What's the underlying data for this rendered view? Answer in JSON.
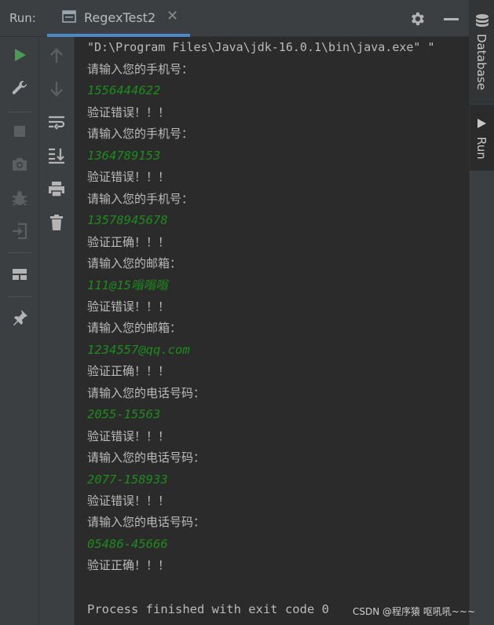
{
  "header": {
    "run_label": "Run:",
    "tab_title": "RegexTest2",
    "tab_close": "✕"
  },
  "console": {
    "command": "\"D:\\Program Files\\Java\\jdk-16.0.1\\bin\\java.exe\" \"",
    "lines": [
      {
        "type": "prompt",
        "text": "请输入您的手机号："
      },
      {
        "type": "input",
        "text": "1556444622"
      },
      {
        "type": "result",
        "text": "验证错误！！！"
      },
      {
        "type": "prompt",
        "text": "请输入您的手机号："
      },
      {
        "type": "input",
        "text": "1364789153"
      },
      {
        "type": "result",
        "text": "验证错误！！！"
      },
      {
        "type": "prompt",
        "text": "请输入您的手机号："
      },
      {
        "type": "input",
        "text": "13578945678"
      },
      {
        "type": "result",
        "text": "验证正确！！！"
      },
      {
        "type": "prompt",
        "text": "请输入您的邮箱："
      },
      {
        "type": "input",
        "text": "111@15嗡嗡嗡"
      },
      {
        "type": "result",
        "text": "验证错误！！！"
      },
      {
        "type": "prompt",
        "text": "请输入您的邮箱："
      },
      {
        "type": "input",
        "text": "1234557@qq.com"
      },
      {
        "type": "result",
        "text": "验证正确！！！"
      },
      {
        "type": "prompt",
        "text": "请输入您的电话号码："
      },
      {
        "type": "input",
        "text": "2055-15563"
      },
      {
        "type": "result",
        "text": "验证错误！！！"
      },
      {
        "type": "prompt",
        "text": "请输入您的电话号码："
      },
      {
        "type": "input",
        "text": "2077-158933"
      },
      {
        "type": "result",
        "text": "验证错误！！！"
      },
      {
        "type": "prompt",
        "text": "请输入您的电话号码："
      },
      {
        "type": "input",
        "text": "05486-45666"
      },
      {
        "type": "result",
        "text": "验证正确！！！"
      }
    ],
    "finish": "Process finished with exit code 0"
  },
  "side_panel": {
    "database_label": "Database",
    "run_label": "Run"
  },
  "watermark": "CSDN @程序猿 呕吼吼~~~",
  "toolbar": {
    "outer_icons": [
      "run-icon",
      "wrench-icon",
      "stop-icon",
      "camera-icon",
      "debug-icon",
      "exit-icon",
      "layout-icon",
      "pin-icon"
    ],
    "inner_icons": [
      "up-arrow-icon",
      "down-arrow-icon",
      "soft-wrap-icon",
      "scroll-to-end-icon",
      "print-icon",
      "trash-icon"
    ]
  },
  "colors": {
    "background": "#2b2b2b",
    "panel": "#3c3f41",
    "text": "#bbbbbb",
    "input_text": "#1c8c1c",
    "accent": "#4a88c7",
    "run_green": "#499c54"
  }
}
